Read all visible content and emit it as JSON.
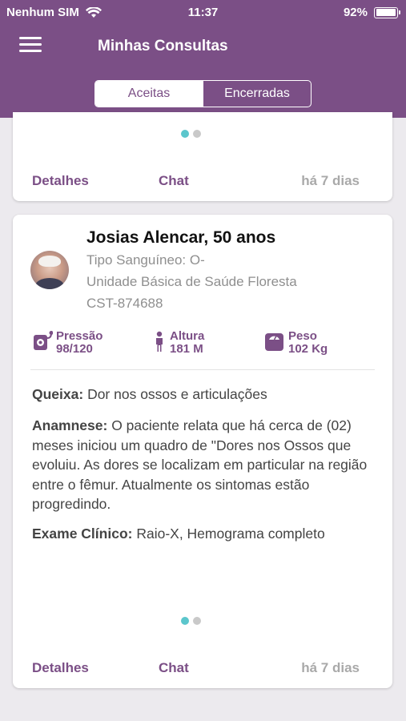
{
  "status_bar": {
    "carrier": "Nenhum SIM",
    "time": "11:37",
    "battery": "92%"
  },
  "header": {
    "title": "Minhas Consultas",
    "tabs": [
      {
        "label": "Aceitas",
        "active": true
      },
      {
        "label": "Encerradas",
        "active": false
      }
    ]
  },
  "colors": {
    "brand": "#7b4f86",
    "dot_active": "#5bc6cc",
    "dot_inactive": "#c9c9c9"
  },
  "card_top": {
    "details_label": "Detalhes",
    "chat_label": "Chat",
    "time_ago": "há 7 dias"
  },
  "card_main": {
    "name": "Josias Alencar, 50 anos",
    "blood_type": "Tipo Sanguíneo: O-",
    "unit": "Unidade Básica de Saúde Floresta",
    "cst": "CST-874688",
    "vitals": {
      "pressure_label": "Pressão",
      "pressure_value": "98/120",
      "height_label": "Altura",
      "height_value": "181 M",
      "weight_label": "Peso",
      "weight_value": "102 Kg"
    },
    "complaint_label": "Queixa:",
    "complaint": " Dor nos ossos e articulações",
    "anamnesis_label": "Anamnese:",
    "anamnesis": " O paciente relata que há cerca de (02) meses iniciou um quadro de \"Dores nos Ossos que evoluiu. As dores se localizam em particular  na região entre o fêmur. Atualmente os sintomas estão progredindo.",
    "exam_label": "Exame Clínico:",
    "exam": " Raio-X, Hemograma completo",
    "details_label": "Detalhes",
    "chat_label": "Chat",
    "time_ago": "há 7 dias"
  }
}
